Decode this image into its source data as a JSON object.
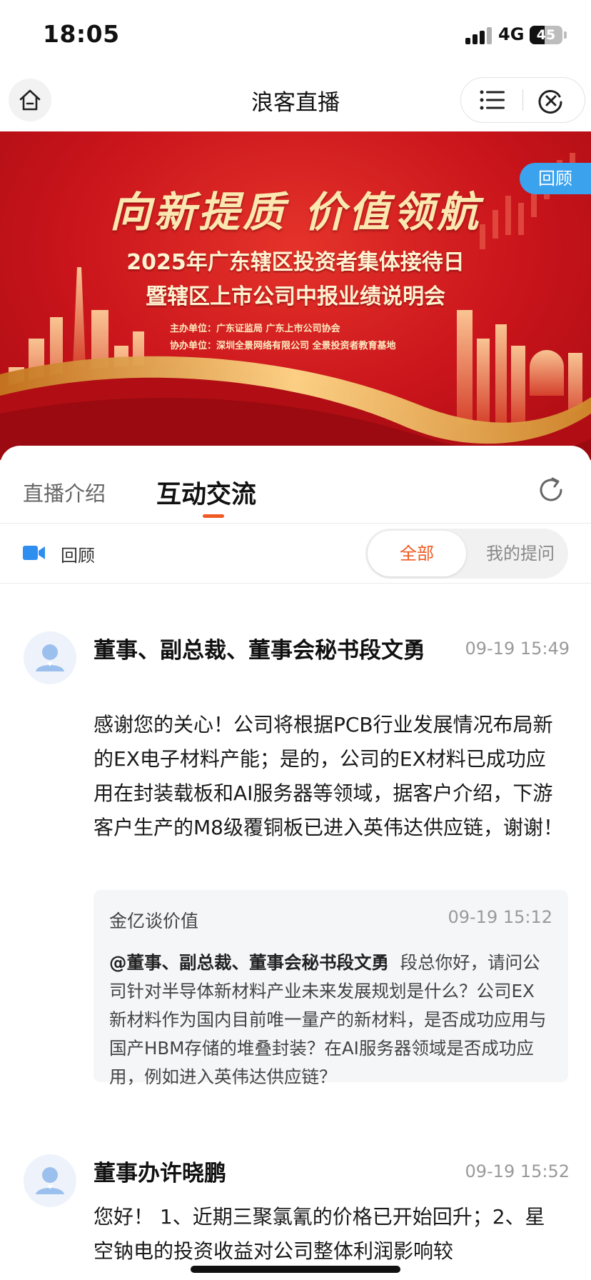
{
  "status_bar": {
    "time": "18:05",
    "network": "4G",
    "battery_level": "45",
    "battery_fraction": 0.45
  },
  "nav": {
    "title": "浪客直播",
    "icons": [
      "home-icon",
      "menu-list-icon",
      "close-circle-icon"
    ]
  },
  "banner": {
    "slogan": "向新提质 价值领航",
    "headline": "2025年广东辖区投资者集体接待日",
    "subheadline": "暨辖区上市公司中报业绩说明会",
    "host_line": "主办单位：广东证监局 广东上市公司协会",
    "co_host_line": "协办单位：深圳全景网络有限公司 全景投资者教育基地",
    "badge": "回顾",
    "colors": {
      "background": "#c9141b",
      "gold": "#f0c060",
      "badge": "#3ba2ee"
    }
  },
  "tabs": [
    {
      "label": "直播介绍",
      "active": false
    },
    {
      "label": "互动交流",
      "active": true
    }
  ],
  "filter": {
    "replay_label": "回顾",
    "options": [
      {
        "label": "全部",
        "selected": true
      },
      {
        "label": "我的提问",
        "selected": false
      }
    ],
    "accent_color": "#f05a22"
  },
  "posts": [
    {
      "author": "董事、副总裁、董事会秘书段文勇",
      "time": "09-19 15:49",
      "answer": "感谢您的关心！公司将根据PCB行业发展情况布局新的EX电子材料产能；是的，公司的EX材料已成功应用在封装载板和AI服务器等领域，据客户介绍，下游客户生产的M8级覆铜板已进入英伟达供应链，谢谢！",
      "question": {
        "user": "金亿谈价值",
        "time": "09-19 15:12",
        "mention": "@董事、副总裁、董事会秘书段文勇",
        "text": "段总你好，请问公司针对半导体新材料产业未来发展规划是什么？公司EX新材料作为国内目前唯一量产的新材料，是否成功应用与国产HBM存储的堆叠封装？在AI服务器领域是否成功应用，例如进入英伟达供应链？"
      }
    },
    {
      "author": "董事办许晓鹏",
      "time": "09-19 15:52",
      "answer": "您好！ 1、近期三聚氯氰的价格已开始回升；2、星空钠电的投资收益对公司整体利润影响较"
    }
  ]
}
